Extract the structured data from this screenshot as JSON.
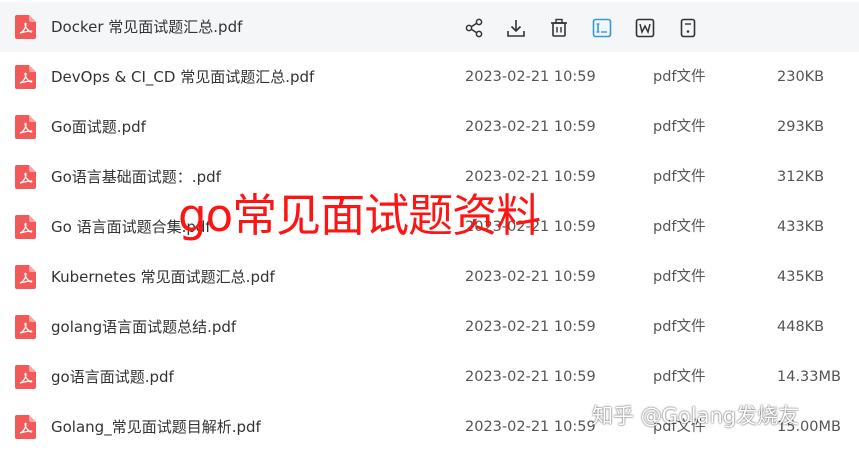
{
  "colors": {
    "pdf_red": "#f25a5a",
    "accent_blue": "#2f9cd8",
    "overlay_red": "#ff1414"
  },
  "files": [
    {
      "name": "Docker 常见面试题汇总.pdf",
      "date": "",
      "type": "",
      "size": "",
      "hovered": true
    },
    {
      "name": "DevOps & CI_CD 常见面试题汇总.pdf",
      "date": "2023-02-21 10:59",
      "type": "pdf文件",
      "size": "230KB"
    },
    {
      "name": "Go面试题.pdf",
      "date": "2023-02-21 10:59",
      "type": "pdf文件",
      "size": "293KB"
    },
    {
      "name": "Go语言基础面试题：.pdf",
      "date": "2023-02-21 10:59",
      "type": "pdf文件",
      "size": "312KB"
    },
    {
      "name": "Go 语言面试题合集.pdf",
      "date": "2023-02-21 10:59",
      "type": "pdf文件",
      "size": "433KB"
    },
    {
      "name": "Kubernetes 常见面试题汇总.pdf",
      "date": "2023-02-21 10:59",
      "type": "pdf文件",
      "size": "435KB"
    },
    {
      "name": "golang语言面试题总结.pdf",
      "date": "2023-02-21 10:59",
      "type": "pdf文件",
      "size": "448KB"
    },
    {
      "name": "go语言面试题.pdf",
      "date": "2023-02-21 10:59",
      "type": "pdf文件",
      "size": "14.33MB"
    },
    {
      "name": "Golang_常见面试题目解析.pdf",
      "date": "2023-02-21 10:59",
      "type": "pdf文件",
      "size": "15.00MB"
    }
  ],
  "row_actions": [
    {
      "icon": "share-icon"
    },
    {
      "icon": "download-icon"
    },
    {
      "icon": "trash-icon"
    },
    {
      "icon": "extract-text-icon"
    },
    {
      "icon": "word-convert-icon"
    },
    {
      "icon": "more-file-icon"
    }
  ],
  "overlay_title": "go常见面试题资料",
  "watermark": "知乎 @Golang发烧友"
}
